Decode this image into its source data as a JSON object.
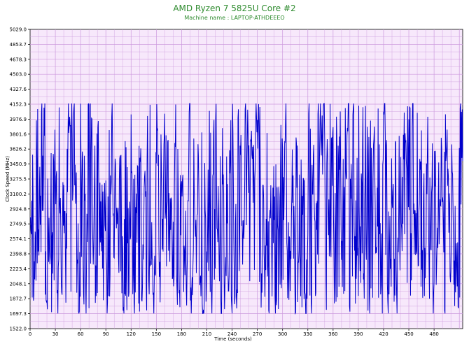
{
  "chart_data": {
    "type": "line",
    "title": "AMD Ryzen 7 5825U Core #2",
    "subtitle": "Machine name : LAPTOP-ATHDEEEO",
    "xlabel": "Time (seconds)",
    "ylabel": "Clock Speed (MHz)",
    "xlim": [
      0,
      514
    ],
    "ylim": [
      1522.0,
      5029.0
    ],
    "grid": true,
    "x_ticks": [
      "0",
      "30",
      "60",
      "90",
      "120",
      "150",
      "180",
      "210",
      "240",
      "270",
      "300",
      "330",
      "360",
      "390",
      "420",
      "450",
      "480"
    ],
    "y_ticks": [
      "1522.0",
      "1697.3",
      "1872.7",
      "2048.1",
      "2223.4",
      "2398.8",
      "2574.1",
      "2749.5",
      "2924.8",
      "3100.2",
      "3275.5",
      "3450.9",
      "3626.2",
      "3801.6",
      "3976.9",
      "4152.3",
      "4327.6",
      "4503.0",
      "4678.3",
      "4853.7",
      "5029.0"
    ],
    "series": [
      {
        "color": "#0000cc",
        "sampling_interval_s": 0.5,
        "min_observed": 1700,
        "max_observed": 4160,
        "typical_range": [
          1900,
          3900
        ]
      }
    ],
    "colors": {
      "plot_background": "#f7e8fb",
      "grid": "#cc99dd",
      "line": "#0000cc",
      "title": "#2e8b2e"
    }
  }
}
